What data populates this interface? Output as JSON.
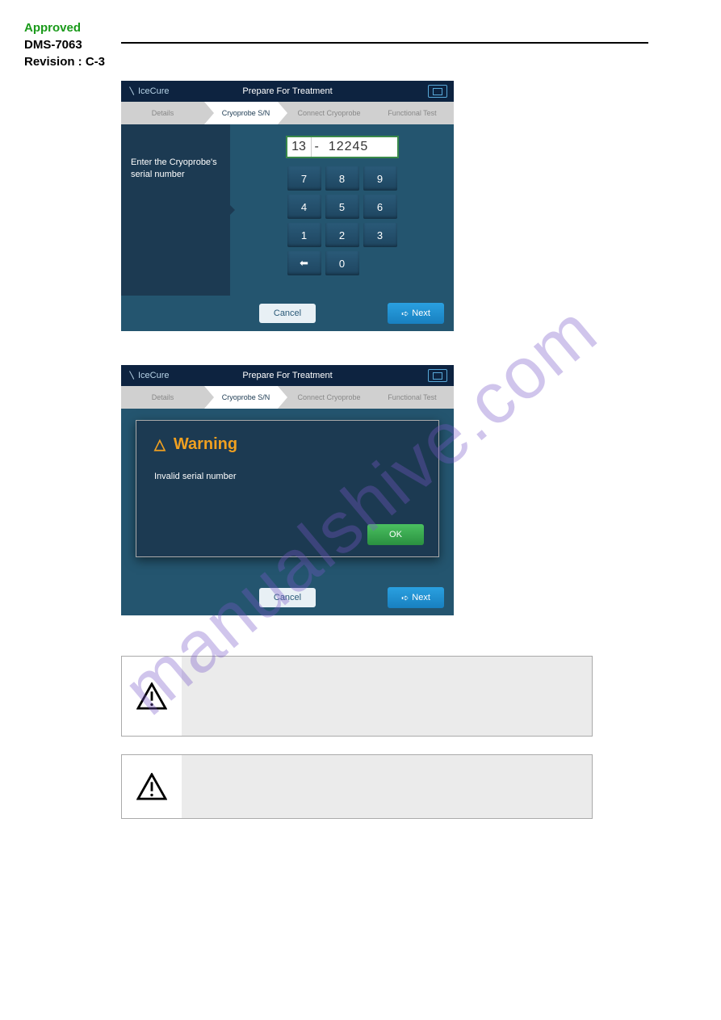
{
  "header": {
    "approved": "Approved",
    "doc": "DMS-7063",
    "revision": "Revision : C-3"
  },
  "watermark": "manualshive.com",
  "screen1": {
    "logo": "IceCure",
    "title": "Prepare For Treatment",
    "steps": {
      "s1": "Details",
      "s2": "Cryoprobe S/N",
      "s3": "Connect Cryoprobe",
      "s4": "Functional Test"
    },
    "prompt": "Enter the Cryoprobe's serial number",
    "sn_prefix": "13",
    "sn_sep": "-",
    "sn_val": "12245",
    "keys": {
      "k7": "7",
      "k8": "8",
      "k9": "9",
      "k4": "4",
      "k5": "5",
      "k6": "6",
      "k1": "1",
      "k2": "2",
      "k3": "3",
      "back": "⬅",
      "k0": "0",
      "empty": ""
    },
    "cancel": "Cancel",
    "next": "Next"
  },
  "screen2": {
    "logo": "IceCure",
    "title": "Prepare For Treatment",
    "steps": {
      "s1": "Details",
      "s2": "Cryoprobe S/N",
      "s3": "Connect Cryoprobe",
      "s4": "Functional Test"
    },
    "warn_title": "Warning",
    "warn_msg": "Invalid serial number",
    "ok": "OK",
    "cancel": "Cancel",
    "next": "Next"
  }
}
